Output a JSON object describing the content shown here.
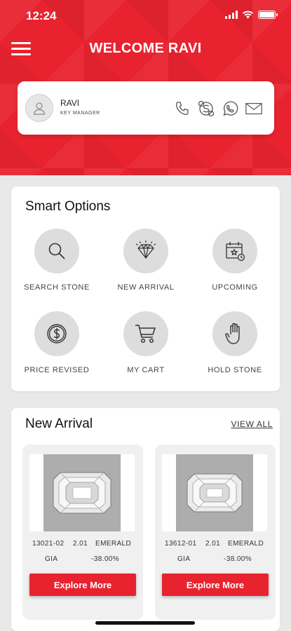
{
  "status_bar": {
    "time": "12:24"
  },
  "header": {
    "title": "WELCOME RAVI"
  },
  "profile": {
    "name": "RAVI",
    "role": "KEY MANAGER",
    "icons": [
      "phone-icon",
      "skype-icon",
      "whatsapp-icon",
      "mail-icon"
    ]
  },
  "smart_options": {
    "title": "Smart Options",
    "items": [
      {
        "label": "SEARCH STONE",
        "icon": "search-icon"
      },
      {
        "label": "NEW ARRIVAL",
        "icon": "diamond-icon"
      },
      {
        "label": "UPCOMING",
        "icon": "calendar-icon"
      },
      {
        "label": "PRICE REVISED",
        "icon": "dollar-icon"
      },
      {
        "label": "MY CART",
        "icon": "cart-icon"
      },
      {
        "label": "HOLD STONE",
        "icon": "hand-icon"
      }
    ]
  },
  "new_arrival": {
    "title": "New Arrival",
    "view_all": "VIEW ALL",
    "products": [
      {
        "stock_id": "13021-02",
        "carat": "2.01",
        "shape": "EMERALD",
        "lab": "GIA",
        "discount": "-38.00%",
        "button": "Explore More"
      },
      {
        "stock_id": "13612-01",
        "carat": "2.01",
        "shape": "EMERALD",
        "lab": "GIA",
        "discount": "-38.00%",
        "button": "Explore More"
      }
    ]
  },
  "colors": {
    "brand_red": "#e8232f",
    "background": "#e9e9e9",
    "icon_circle": "#dddddd"
  }
}
